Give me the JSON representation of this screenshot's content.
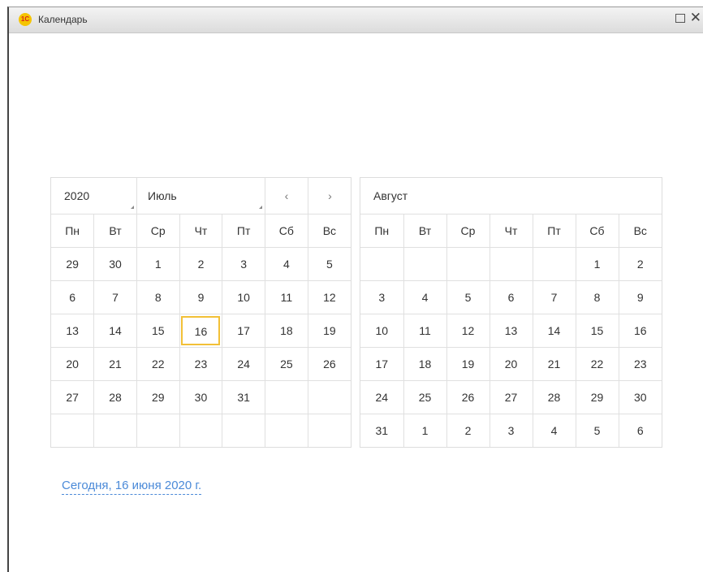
{
  "window": {
    "title": "Календарь",
    "logo_text": "1С"
  },
  "left": {
    "year": "2020",
    "month": "Июль",
    "prev": "‹",
    "next": "›",
    "weekdays": [
      "Пн",
      "Вт",
      "Ср",
      "Чт",
      "Пт",
      "Сб",
      "Вс"
    ],
    "weeks": [
      [
        "29",
        "30",
        "1",
        "2",
        "3",
        "4",
        "5"
      ],
      [
        "6",
        "7",
        "8",
        "9",
        "10",
        "11",
        "12"
      ],
      [
        "13",
        "14",
        "15",
        "16",
        "17",
        "18",
        "19"
      ],
      [
        "20",
        "21",
        "22",
        "23",
        "24",
        "25",
        "26"
      ],
      [
        "27",
        "28",
        "29",
        "30",
        "31",
        "",
        ""
      ],
      [
        "",
        "",
        "",
        "",
        "",
        "",
        ""
      ]
    ]
  },
  "right": {
    "month": "Август",
    "weekdays": [
      "Пн",
      "Вт",
      "Ср",
      "Чт",
      "Пт",
      "Сб",
      "Вс"
    ],
    "weeks": [
      [
        "",
        "",
        "",
        "",
        "",
        "1",
        "2"
      ],
      [
        "3",
        "4",
        "5",
        "6",
        "7",
        "8",
        "9"
      ],
      [
        "10",
        "11",
        "12",
        "13",
        "14",
        "15",
        "16"
      ],
      [
        "17",
        "18",
        "19",
        "20",
        "21",
        "22",
        "23"
      ],
      [
        "24",
        "25",
        "26",
        "27",
        "28",
        "29",
        "30"
      ],
      [
        "31",
        "1",
        "2",
        "3",
        "4",
        "5",
        "6"
      ]
    ]
  },
  "today_link": "Сегодня, 16 июня 2020 г.",
  "colors": {
    "weekend": "#f0562a",
    "other_month": "#a0a0a0",
    "selected_border": "#f2c037",
    "link": "#4b8ad8"
  }
}
